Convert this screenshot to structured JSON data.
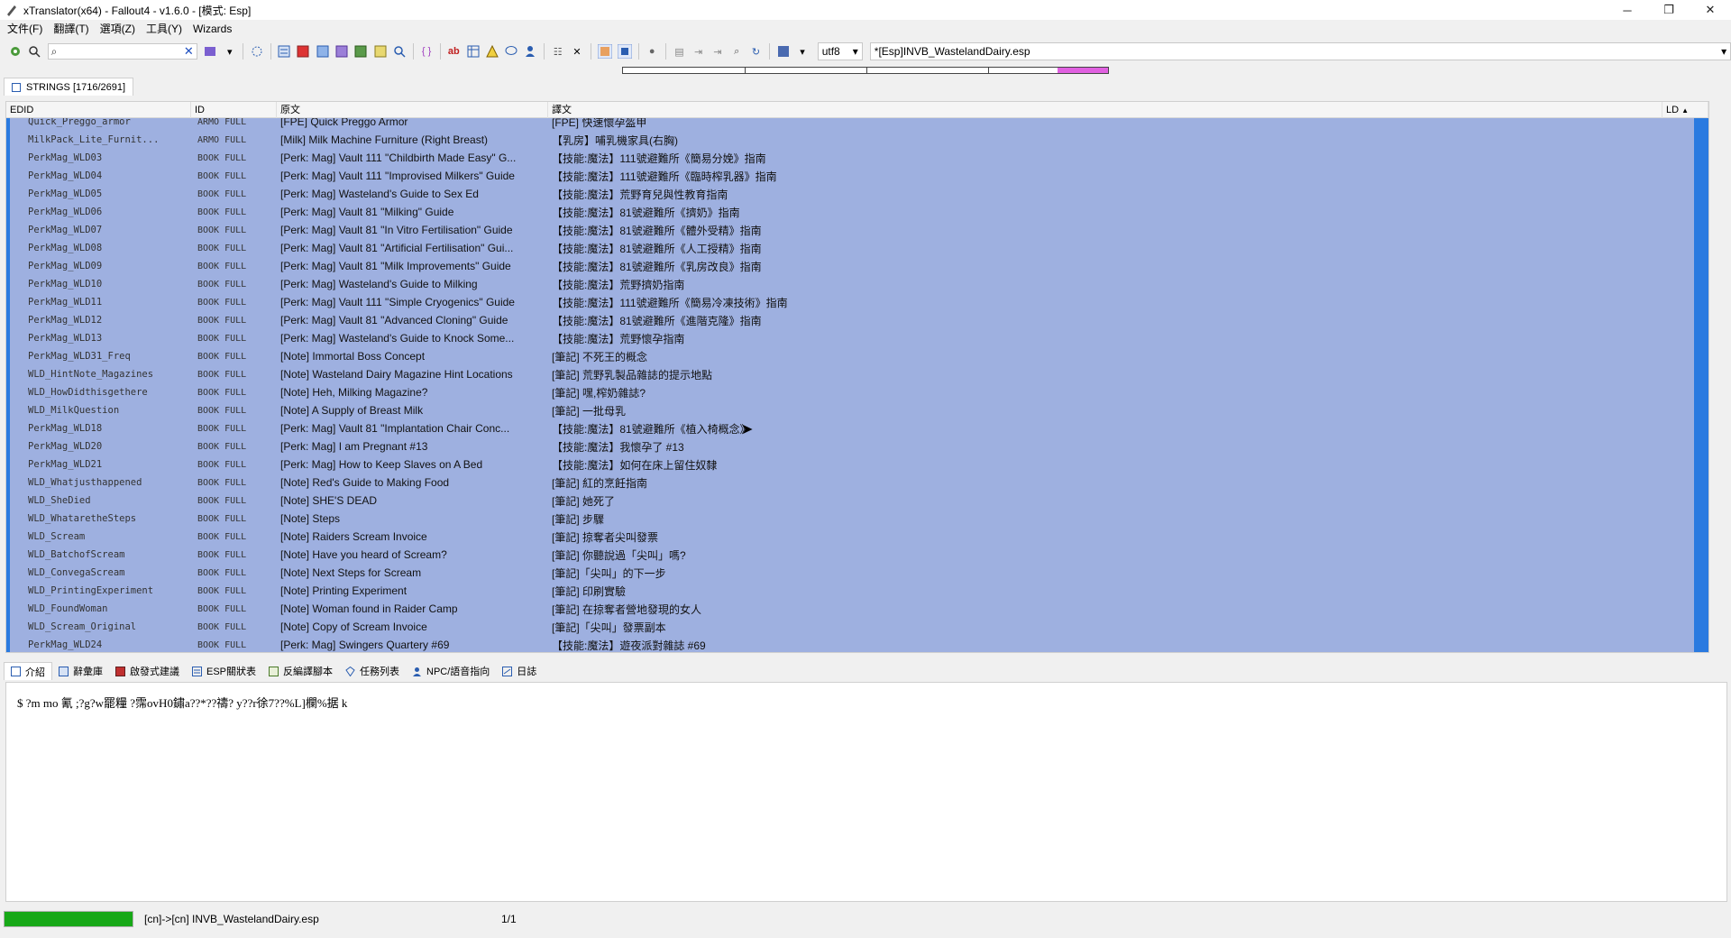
{
  "window": {
    "title": "xTranslator(x64) - Fallout4 - v1.6.0 - [模式: Esp]",
    "controls": [
      "─",
      "❐",
      "✕"
    ]
  },
  "menu": [
    "文件(F)",
    "翻譯(T)",
    "選項(Z)",
    "工具(Y)",
    "Wizards"
  ],
  "toolbar": {
    "search_value": "",
    "encoding": "utf8",
    "file": "*[Esp]INVB_WastelandDairy.esp"
  },
  "strings_tab": {
    "label": "STRINGS [1716/2691]"
  },
  "grid": {
    "columns": [
      "EDID",
      "ID",
      "原文",
      "譯文",
      "LD"
    ],
    "rows": [
      {
        "edid": "Quick_Preggo_armor",
        "id": "ARMO FULL",
        "src": "[FPE] Quick Preggo Armor",
        "dst": "[FPE] 快速懷孕盔甲"
      },
      {
        "edid": "MilkPack_Lite_Furnit...",
        "id": "ARMO FULL",
        "src": "[Milk] Milk Machine Furniture (Right Breast)",
        "dst": "【乳房】哺乳機家具(右胸)"
      },
      {
        "edid": "PerkMag_WLD03",
        "id": "BOOK FULL",
        "src": "[Perk: Mag] Vault 111 \"Childbirth Made Easy\" G...",
        "dst": "【技能:魔法】111號避難所《簡易分娩》指南"
      },
      {
        "edid": "PerkMag_WLD04",
        "id": "BOOK FULL",
        "src": "[Perk: Mag] Vault 111 \"Improvised Milkers\" Guide",
        "dst": "【技能:魔法】111號避難所《臨時榨乳器》指南"
      },
      {
        "edid": "PerkMag_WLD05",
        "id": "BOOK FULL",
        "src": "[Perk: Mag] Wasteland's Guide to Sex Ed",
        "dst": "【技能:魔法】荒野育兒與性教育指南"
      },
      {
        "edid": "PerkMag_WLD06",
        "id": "BOOK FULL",
        "src": "[Perk: Mag] Vault 81 \"Milking\" Guide",
        "dst": "【技能:魔法】81號避難所《擠奶》指南"
      },
      {
        "edid": "PerkMag_WLD07",
        "id": "BOOK FULL",
        "src": "[Perk: Mag] Vault 81 \"In Vitro Fertilisation\" Guide",
        "dst": "【技能:魔法】81號避難所《體外受精》指南"
      },
      {
        "edid": "PerkMag_WLD08",
        "id": "BOOK FULL",
        "src": "[Perk: Mag] Vault 81 \"Artificial Fertilisation\" Gui...",
        "dst": "【技能:魔法】81號避難所《人工授精》指南"
      },
      {
        "edid": "PerkMag_WLD09",
        "id": "BOOK FULL",
        "src": "[Perk: Mag] Vault 81 \"Milk Improvements\" Guide",
        "dst": "【技能:魔法】81號避難所《乳房改良》指南"
      },
      {
        "edid": "PerkMag_WLD10",
        "id": "BOOK FULL",
        "src": "[Perk: Mag] Wasteland's Guide to Milking",
        "dst": "【技能:魔法】荒野擠奶指南"
      },
      {
        "edid": "PerkMag_WLD11",
        "id": "BOOK FULL",
        "src": "[Perk: Mag] Vault 111 \"Simple Cryogenics\" Guide",
        "dst": "【技能:魔法】111號避難所《簡易冷凍技術》指南"
      },
      {
        "edid": "PerkMag_WLD12",
        "id": "BOOK FULL",
        "src": "[Perk: Mag] Vault 81 \"Advanced Cloning\" Guide",
        "dst": "【技能:魔法】81號避難所《進階克隆》指南"
      },
      {
        "edid": "PerkMag_WLD13",
        "id": "BOOK FULL",
        "src": "[Perk: Mag] Wasteland's Guide to Knock Some...",
        "dst": "【技能:魔法】荒野懷孕指南"
      },
      {
        "edid": "PerkMag_WLD31_Freq",
        "id": "BOOK FULL",
        "src": "[Note] Immortal Boss Concept",
        "dst": "[筆記] 不死王的概念"
      },
      {
        "edid": "WLD_HintNote_Magazines",
        "id": "BOOK FULL",
        "src": "[Note] Wasteland Dairy Magazine Hint Locations",
        "dst": "[筆記] 荒野乳製品雜誌的提示地點"
      },
      {
        "edid": "WLD_HowDidthisgethere",
        "id": "BOOK FULL",
        "src": "[Note] Heh, Milking Magazine?",
        "dst": "[筆記] 嘿,榨奶雜誌?"
      },
      {
        "edid": "WLD_MilkQuestion",
        "id": "BOOK FULL",
        "src": "[Note] A Supply of Breast Milk",
        "dst": "[筆記] 一批母乳"
      },
      {
        "edid": "PerkMag_WLD18",
        "id": "BOOK FULL",
        "src": "[Perk: Mag] Vault 81 \"Implantation Chair Conc...",
        "dst": "【技能:魔法】81號避難所《植入椅概念》"
      },
      {
        "edid": "PerkMag_WLD20",
        "id": "BOOK FULL",
        "src": "[Perk: Mag] I am Pregnant #13",
        "dst": "【技能:魔法】我懷孕了 #13"
      },
      {
        "edid": "PerkMag_WLD21",
        "id": "BOOK FULL",
        "src": "[Perk: Mag] How to Keep Slaves on A Bed",
        "dst": "【技能:魔法】如何在床上留住奴隸"
      },
      {
        "edid": "WLD_Whatjusthappened",
        "id": "BOOK FULL",
        "src": "[Note] Red's Guide to Making Food",
        "dst": "[筆記] 紅的烹飪指南"
      },
      {
        "edid": "WLD_SheDied",
        "id": "BOOK FULL",
        "src": "[Note] SHE'S DEAD",
        "dst": "[筆記] 她死了"
      },
      {
        "edid": "WLD_WhataretheSteps",
        "id": "BOOK FULL",
        "src": "[Note] Steps",
        "dst": "[筆記] 步驟"
      },
      {
        "edid": "WLD_Scream",
        "id": "BOOK FULL",
        "src": "[Note] Raiders Scream Invoice",
        "dst": "[筆記] 掠奪者尖叫發票"
      },
      {
        "edid": "WLD_BatchofScream",
        "id": "BOOK FULL",
        "src": "[Note] Have you heard of Scream?",
        "dst": "[筆記] 你聽說過「尖叫」嗎?"
      },
      {
        "edid": "WLD_ConvegaScream",
        "id": "BOOK FULL",
        "src": "[Note] Next Steps for Scream",
        "dst": "[筆記]「尖叫」的下一步"
      },
      {
        "edid": "WLD_PrintingExperiment",
        "id": "BOOK FULL",
        "src": "[Note] Printing Experiment",
        "dst": "[筆記] 印刷實驗"
      },
      {
        "edid": "WLD_FoundWoman",
        "id": "BOOK FULL",
        "src": "[Note] Woman found in Raider Camp",
        "dst": "[筆記] 在掠奪者營地發現的女人"
      },
      {
        "edid": "WLD_Scream_Original",
        "id": "BOOK FULL",
        "src": "[Note] Copy of Scream Invoice",
        "dst": "[筆記]「尖叫」發票副本"
      },
      {
        "edid": "PerkMag_WLD24",
        "id": "BOOK FULL",
        "src": "[Perk: Mag] Swingers Quartery #69",
        "dst": "【技能:魔法】遊夜派對雜誌 #69"
      }
    ]
  },
  "bottom_tabs": [
    "介紹",
    "辭彙庫",
    "啟發式建議",
    "ESP關狀表",
    "反編譯腳本",
    "任務列表",
    "NPC/語音指向",
    "日誌"
  ],
  "detail_text": "$ ?m   mo    氰    ;?g?w罷糧  ?霈ovH0鏽a??*??禱?       y??r徐7??%L]欄%据    k",
  "status": {
    "file": "[cn]->[cn] INVB_WastelandDairy.esp",
    "page": "1/1"
  },
  "colors": {
    "row_selected": "#9eb0e0",
    "accent": "#2a7ae0",
    "progress": "#17a817",
    "ruler_fill": "#e060e0"
  }
}
